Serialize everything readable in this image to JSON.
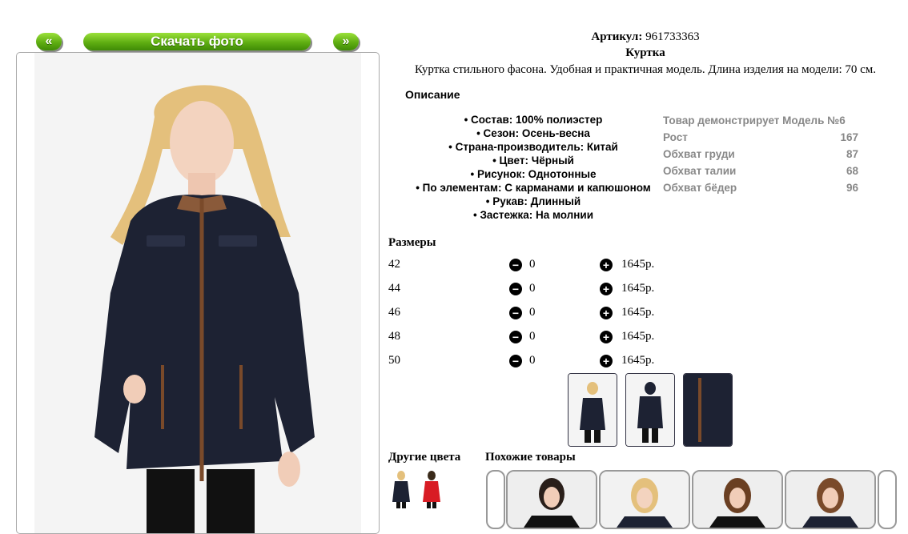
{
  "nav": {
    "prev_label": "«",
    "download_label": "Скачать фото",
    "next_label": "»"
  },
  "product": {
    "article_label": "Артикул:",
    "article_value": "961733363",
    "name": "Куртка",
    "short_description": "Куртка стильного фасона. Удобная и практичная модель. Длина изделия на модели: 70 см."
  },
  "description_title": "Описание",
  "properties": [
    "• Состав: 100% полиэстер",
    "• Сезон: Осень-весна",
    "• Страна-производитель: Китай",
    "• Цвет: Чёрный",
    "• Рисунок: Однотонные",
    "• По элементам: С карманами и капюшоном",
    "• Рукав: Длинный",
    "• Застежка: На молнии"
  ],
  "model_info": {
    "title": "Товар демонстрирует Модель №6",
    "rows": [
      {
        "label": "Рост",
        "value": "167"
      },
      {
        "label": "Обхват груди",
        "value": "87"
      },
      {
        "label": "Обхват талии",
        "value": "68"
      },
      {
        "label": "Обхват бёдер",
        "value": "96"
      }
    ]
  },
  "sizes_title": "Размеры",
  "sizes": [
    {
      "size": "42",
      "qty": "0",
      "price": "1645р."
    },
    {
      "size": "44",
      "qty": "0",
      "price": "1645р."
    },
    {
      "size": "46",
      "qty": "0",
      "price": "1645р."
    },
    {
      "size": "48",
      "qty": "0",
      "price": "1645р."
    },
    {
      "size": "50",
      "qty": "0",
      "price": "1645р."
    }
  ],
  "other_colors_title": "Другие цвета",
  "similar_title": "Похожие товары",
  "colors": {
    "accent_green": "#5fae12",
    "jacket_navy": "#1d2233",
    "swatch_red": "#d81c24",
    "muted_text": "#888888"
  }
}
